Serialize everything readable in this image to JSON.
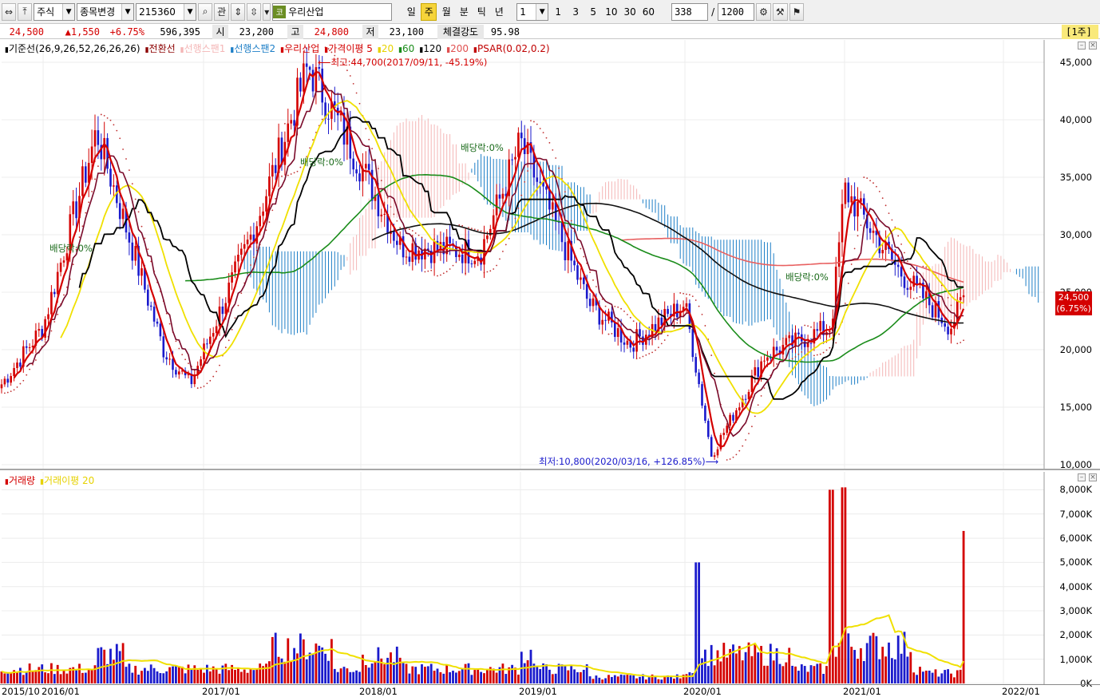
{
  "toolbar": {
    "market": "주식",
    "mode": "종목변경",
    "code": "215360",
    "btn_watch": "관",
    "stock_badge": "코",
    "stock_name": "우리산업",
    "periods": [
      "일",
      "주",
      "월",
      "분",
      "틱",
      "년"
    ],
    "active_period": "주",
    "interval_value": "1",
    "interval_options": [
      "1",
      "3",
      "5",
      "10",
      "30",
      "60"
    ],
    "count": "338",
    "separator": "/",
    "total": "1200"
  },
  "info": {
    "price": "24,500",
    "change": "▲1,550",
    "change_pct": "+6.75%",
    "volume": "596,395",
    "open_label": "시",
    "open": "23,200",
    "high_label": "고",
    "high": "24,800",
    "low_label": "저",
    "low": "23,100",
    "strength_label": "체결강도",
    "strength": "95.98",
    "period_tag": "[1주]"
  },
  "price_panel": {
    "legend": [
      {
        "text": "기준선(26,9,26,52,26,26,26)",
        "color": "#000000"
      },
      {
        "text": "전환선",
        "color": "#8b0000"
      },
      {
        "text": "선행스팬1",
        "color": "#f4b6b6"
      },
      {
        "text": "선행스팬2",
        "color": "#1e7fc7"
      },
      {
        "text": "우리산업",
        "color": "#d40000"
      },
      {
        "text": "가격이평 5",
        "color": "#d40000"
      },
      {
        "text": "20",
        "color": "#e6d200"
      },
      {
        "text": "60",
        "color": "#1a8c1a"
      },
      {
        "text": "120",
        "color": "#000000"
      },
      {
        "text": "200",
        "color": "#e05050"
      },
      {
        "text": "PSAR(0.02,0.2)",
        "color": "#c00000"
      }
    ],
    "y_labels": [
      "45,000",
      "40,000",
      "35,000",
      "30,000",
      "25,000",
      "20,000",
      "15,000",
      "10,000"
    ],
    "current_price": "24,500",
    "current_pct": "(6.75%)",
    "annotations": {
      "high": "최고:44,700(2017/09/11, -45.19%)",
      "low": "최저:10,800(2020/03/16, +126.85%)",
      "dividend": "배당락:0%"
    }
  },
  "volume_panel": {
    "legend": [
      {
        "text": "거래량",
        "color": "#d40000"
      },
      {
        "text": "거래이평 20",
        "color": "#e6d200"
      }
    ],
    "y_labels": [
      "8,000K",
      "7,000K",
      "6,000K",
      "5,000K",
      "4,000K",
      "3,000K",
      "2,000K",
      "1,000K",
      "0K"
    ]
  },
  "date_labels": [
    "2015/10",
    "2016/01",
    "2017/01",
    "2018/01",
    "2019/01",
    "2020/01",
    "2021/01",
    "2022/01"
  ],
  "colors": {
    "up": "#d40000",
    "down": "#1a1acc",
    "ma20": "#f0e000",
    "ma60": "#1a8c1a",
    "ma120": "#111111",
    "ma200": "#e86060",
    "kijun": "#000000",
    "tenkan": "#7a0a2a",
    "span1": "#f4b6b6",
    "span2": "#1e7fc7"
  },
  "chart_data": {
    "type": "candlestick",
    "ylim": [
      10000,
      46000
    ],
    "keypoints": [
      {
        "date": "2015/10",
        "close": 17000
      },
      {
        "date": "2016/01",
        "close": 22000
      },
      {
        "date": "2016/05",
        "close": 39000
      },
      {
        "date": "2016/10",
        "close": 20000
      },
      {
        "date": "2016/12",
        "close": 17000
      },
      {
        "date": "2017/05",
        "close": 31000
      },
      {
        "date": "2017/09",
        "close": 44700
      },
      {
        "date": "2018/01",
        "close": 36000
      },
      {
        "date": "2018/04",
        "close": 29000
      },
      {
        "date": "2018/10",
        "close": 28500
      },
      {
        "date": "2019/01",
        "close": 38000
      },
      {
        "date": "2019/06",
        "close": 24000
      },
      {
        "date": "2019/09",
        "close": 20500
      },
      {
        "date": "2020/01",
        "close": 24000
      },
      {
        "date": "2020/03",
        "close": 10800
      },
      {
        "date": "2020/07",
        "close": 19500
      },
      {
        "date": "2020/12",
        "close": 22000
      },
      {
        "date": "2021/01",
        "close": 34000
      },
      {
        "date": "2021/05",
        "close": 27000
      },
      {
        "date": "2021/09",
        "close": 22000
      },
      {
        "date": "2021/10",
        "close": 24500
      }
    ],
    "volume_peaks": [
      {
        "date": "2020/02",
        "value": 5000000
      },
      {
        "date": "2020/12",
        "value": 8000000
      },
      {
        "date": "2021/01",
        "value": 8100000
      },
      {
        "date": "2021/10",
        "value": 6300000
      }
    ]
  }
}
